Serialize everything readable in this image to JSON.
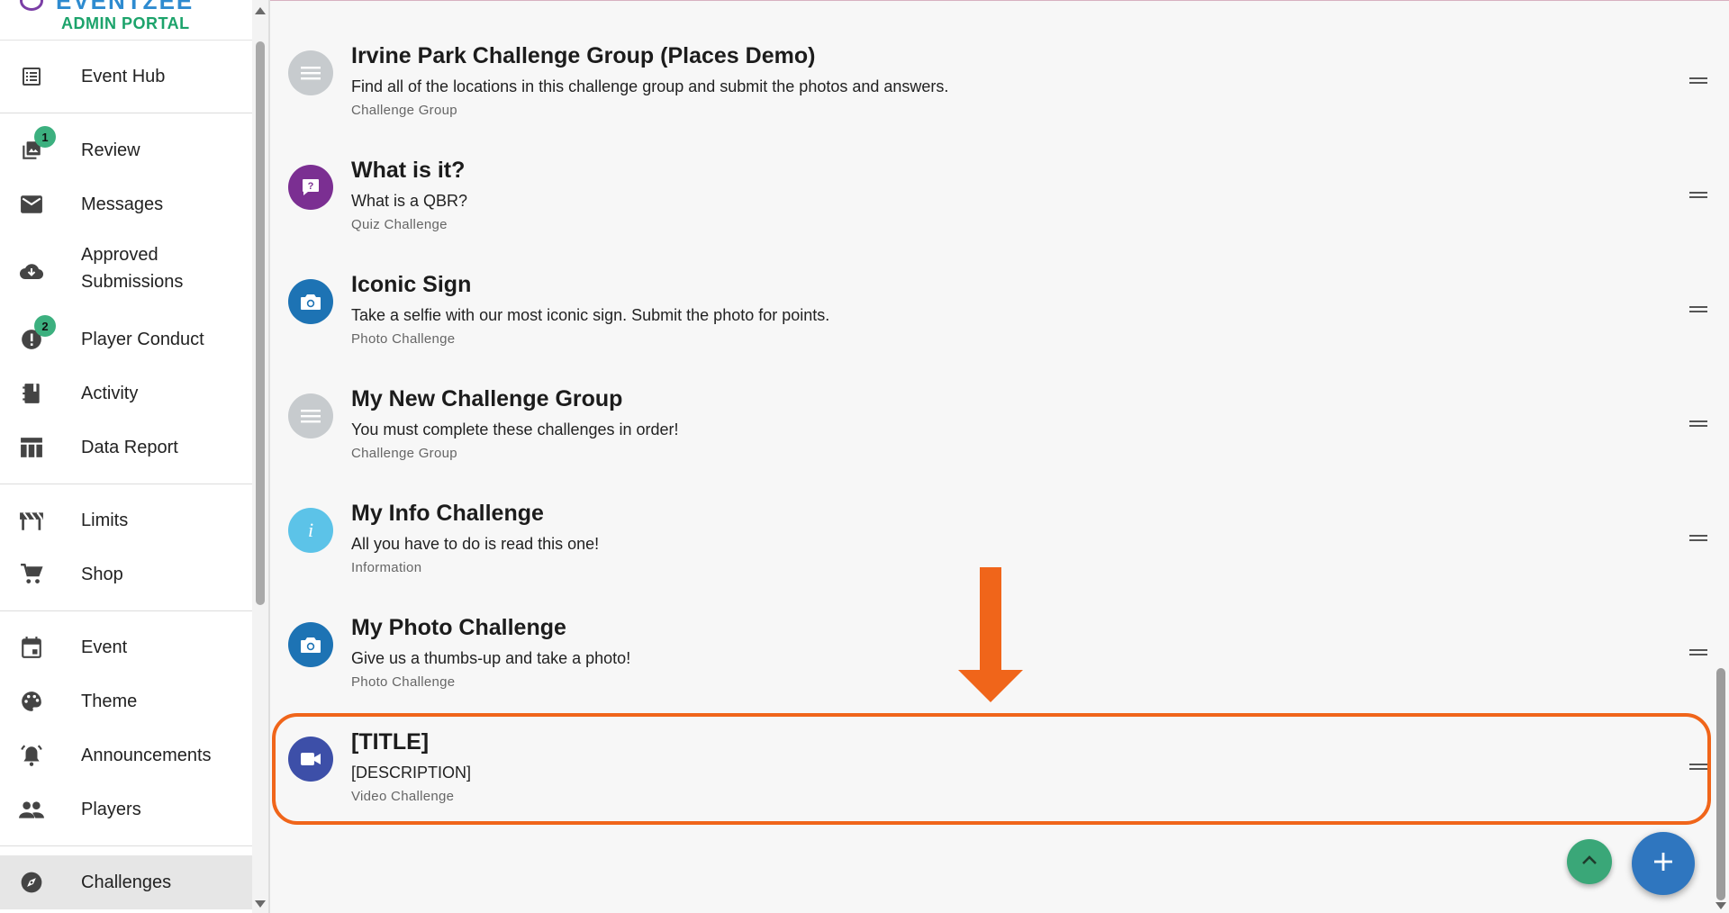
{
  "brand": {
    "logo_text": "EVENTZEE",
    "subtitle": "ADMIN PORTAL"
  },
  "sidebar": {
    "items": [
      {
        "label": "Event Hub",
        "icon": "list-icon"
      },
      {
        "label": "Review",
        "icon": "photo-library-icon",
        "badge": "1"
      },
      {
        "label": "Messages",
        "icon": "mail-icon"
      },
      {
        "label": "Approved Submissions",
        "icon": "cloud-download-icon"
      },
      {
        "label": "Player Conduct",
        "icon": "alert-badge-icon",
        "badge": "2"
      },
      {
        "label": "Activity",
        "icon": "notebook-icon"
      },
      {
        "label": "Data Report",
        "icon": "table-icon"
      },
      {
        "label": "Limits",
        "icon": "barrier-icon"
      },
      {
        "label": "Shop",
        "icon": "cart-icon"
      },
      {
        "label": "Event",
        "icon": "calendar-icon"
      },
      {
        "label": "Theme",
        "icon": "palette-icon"
      },
      {
        "label": "Announcements",
        "icon": "bell-ring-icon"
      },
      {
        "label": "Players",
        "icon": "people-icon"
      },
      {
        "label": "Challenges",
        "icon": "compass-icon",
        "active": true
      }
    ]
  },
  "challenges": [
    {
      "title": "Irvine Park Challenge Group (Places Demo)",
      "description": "Find all of the locations in this challenge group and submit the photos and answers.",
      "type": "Challenge Group",
      "icon": "list-lines-icon",
      "color": "#c7cbce"
    },
    {
      "title": "What is it?",
      "description": "What is a QBR?",
      "type": "Quiz Challenge",
      "icon": "question-chat-icon",
      "color": "#7b2f92"
    },
    {
      "title": "Iconic Sign",
      "description": "Take a selfie with our most iconic sign. Submit the photo for points.",
      "type": "Photo Challenge",
      "icon": "camera-icon",
      "color": "#1d73b4"
    },
    {
      "title": "My New Challenge Group",
      "description": "You must complete these challenges in order!",
      "type": "Challenge Group",
      "icon": "list-lines-icon",
      "color": "#c7cbce"
    },
    {
      "title": "My Info Challenge",
      "description": "All you have to do is read this one!",
      "type": "Information",
      "icon": "info-icon",
      "color": "#5cc3e8"
    },
    {
      "title": "My Photo Challenge",
      "description": "Give us a thumbs-up and take a photo!",
      "type": "Photo Challenge",
      "icon": "camera-icon",
      "color": "#1d73b4"
    },
    {
      "title": "[TITLE]",
      "description": "[DESCRIPTION]",
      "type": "Video Challenge",
      "icon": "video-camera-icon",
      "color": "#3d4fa8"
    }
  ],
  "highlight": {
    "color": "#f0651a"
  },
  "actions": {
    "scroll_top": "chevron-up-icon",
    "add": "plus-icon"
  }
}
